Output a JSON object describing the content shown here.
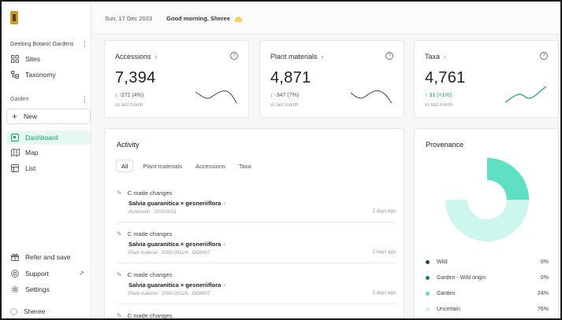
{
  "sidebar": {
    "org_name": "Geelong Botanic Gardens",
    "items_top": [
      {
        "label": "Sites",
        "icon": "grid-icon"
      },
      {
        "label": "Taxonomy",
        "icon": "tree-icon"
      }
    ],
    "section_label": "Garden",
    "new_label": "New",
    "items_garden": [
      {
        "label": "Dashboard",
        "icon": "dashboard-icon",
        "active": true
      },
      {
        "label": "Map",
        "icon": "map-icon"
      },
      {
        "label": "List",
        "icon": "list-icon"
      }
    ],
    "items_bottom": [
      {
        "label": "Refer and save",
        "icon": "gift-icon"
      },
      {
        "label": "Support",
        "icon": "support-icon",
        "external": "↗"
      },
      {
        "label": "Settings",
        "icon": "gear-icon"
      }
    ],
    "user": "Sheree"
  },
  "topbar": {
    "date": "Sun, 17 Dec 2023",
    "greeting": "Good morning, Sheree"
  },
  "stats": [
    {
      "title": "Accessions",
      "value": "7,394",
      "change": "↓ -272 (4%)",
      "direction": "down",
      "sub": "vs last month"
    },
    {
      "title": "Plant materials",
      "value": "4,871",
      "change": "↓ -347 (7%)",
      "direction": "down",
      "sub": "vs last month"
    },
    {
      "title": "Taxa",
      "value": "4,761",
      "change": "↑ 31 (<1%)",
      "direction": "up",
      "sub": "vs last month"
    }
  ],
  "activity": {
    "title": "Activity",
    "tabs": [
      "All",
      "Plant materials",
      "Accessions",
      "Taxa"
    ],
    "active_tab": "All",
    "items": [
      {
        "action": "C made changes",
        "name": "Salvia guaranitica × gesneriiflora",
        "meta": "Accession · 2000-0011",
        "time": "2 days ago"
      },
      {
        "action": "C made changes",
        "name": "Salvia guaranitica × gesneriiflora",
        "meta": "Plant material · 2000-0011/4 · OG8407",
        "time": "2 days ago"
      },
      {
        "action": "C made changes",
        "name": "Salvia guaranitica × gesneriiflora",
        "meta": "Plant material · 2000-0011/5 · OG8407",
        "time": "2 days ago"
      },
      {
        "action": "C made changes"
      }
    ]
  },
  "provenance": {
    "title": "Provenance",
    "legend": [
      {
        "label": "Wild",
        "value": "0%",
        "color": "#1f4d3a"
      },
      {
        "label": "Garden - Wild origin",
        "value": "0%",
        "color": "#138a68"
      },
      {
        "label": "Garden",
        "value": "24%",
        "color": "#5fe0c2"
      },
      {
        "label": "Uncertain",
        "value": "76%",
        "color": "#cdf6ec"
      }
    ]
  },
  "colors": {
    "accent": "#17a37a",
    "accent_light": "#e6f8f2"
  }
}
